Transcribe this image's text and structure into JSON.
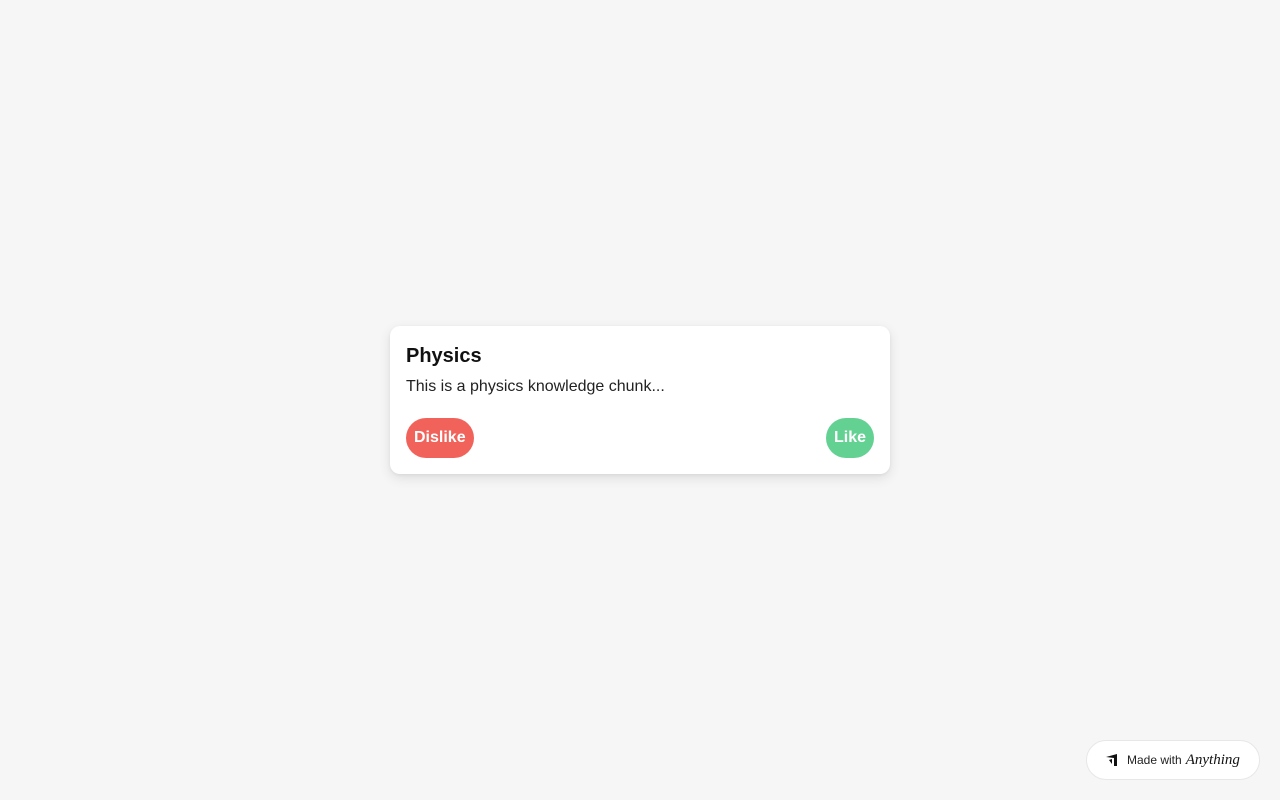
{
  "card": {
    "title": "Physics",
    "text": "This is a physics knowledge chunk...",
    "dislike_label": "Dislike",
    "like_label": "Like"
  },
  "badge": {
    "prefix": "Made with",
    "brand": "Anything",
    "icon": "anything-logo-icon"
  },
  "colors": {
    "background": "#f6f6f6",
    "dislike": "#f1635a",
    "like": "#62d192"
  }
}
